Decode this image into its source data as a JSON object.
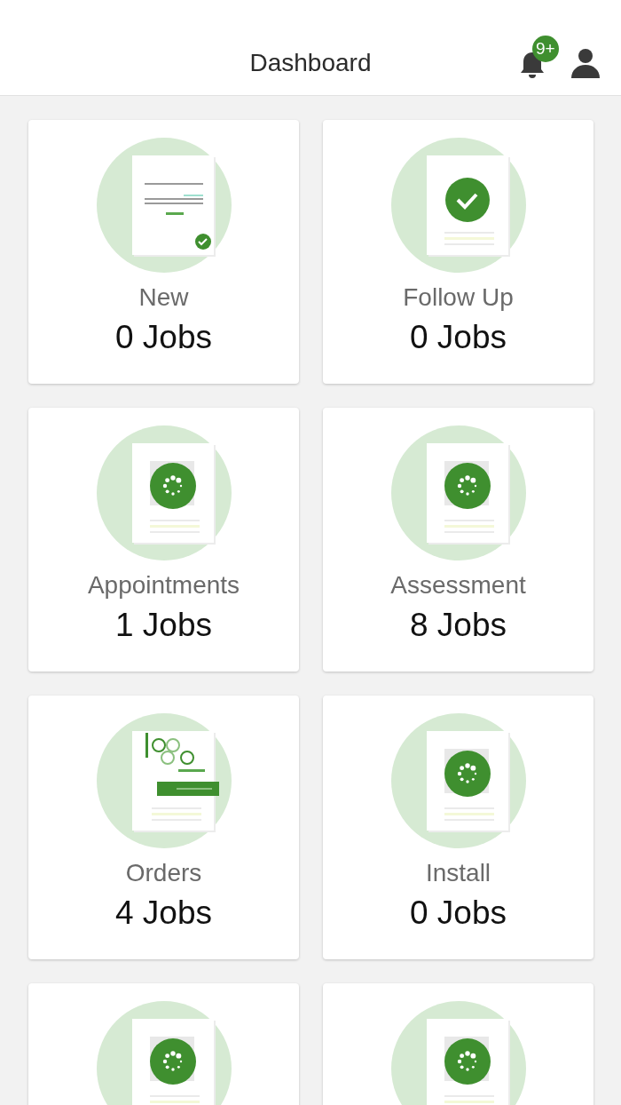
{
  "header": {
    "title": "Dashboard",
    "notification_badge": "9+"
  },
  "cards": [
    {
      "kind": "document",
      "label": "New",
      "count": "0 Jobs"
    },
    {
      "kind": "check",
      "label": "Follow Up",
      "count": "0 Jobs"
    },
    {
      "kind": "spinner",
      "label": "Appointments",
      "count": "1 Jobs"
    },
    {
      "kind": "spinner",
      "label": "Assessment",
      "count": "8 Jobs"
    },
    {
      "kind": "order",
      "label": "Orders",
      "count": "4 Jobs"
    },
    {
      "kind": "spinner",
      "label": "Install",
      "count": "0 Jobs"
    },
    {
      "kind": "spinner"
    },
    {
      "kind": "spinner"
    }
  ]
}
